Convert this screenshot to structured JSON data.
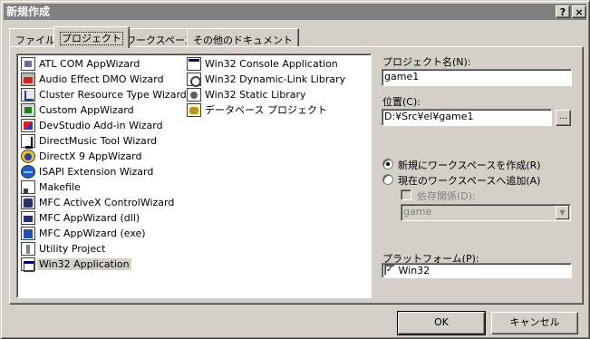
{
  "window": {
    "title": "新規作成",
    "help_label": "?",
    "close_label": "×"
  },
  "tabs": [
    {
      "label": "ファイル",
      "active": false
    },
    {
      "label": "プロジェクト",
      "active": true
    },
    {
      "label": "ワークスペース",
      "active": false
    },
    {
      "label": "その他のドキュメント",
      "active": false
    }
  ],
  "project_types_left": [
    {
      "label": "ATL COM AppWizard",
      "icon": "atl-wizard-icon"
    },
    {
      "label": "Audio Effect DMO Wizard",
      "icon": "audio-dmo-icon"
    },
    {
      "label": "Cluster Resource Type Wizard",
      "icon": "cluster-resource-icon"
    },
    {
      "label": "Custom AppWizard",
      "icon": "custom-wizard-icon"
    },
    {
      "label": "DevStudio Add-in Wizard",
      "icon": "devstudio-addin-icon"
    },
    {
      "label": "DirectMusic Tool Wizard",
      "icon": "directmusic-icon"
    },
    {
      "label": "DirectX 9 AppWizard",
      "icon": "directx-icon"
    },
    {
      "label": "ISAPI Extension Wizard",
      "icon": "isapi-icon"
    },
    {
      "label": "Makefile",
      "icon": "makefile-icon"
    },
    {
      "label": "MFC ActiveX ControlWizard",
      "icon": "mfc-activex-icon"
    },
    {
      "label": "MFC AppWizard (dll)",
      "icon": "mfc-dll-icon"
    },
    {
      "label": "MFC AppWizard (exe)",
      "icon": "mfc-exe-icon"
    },
    {
      "label": "Utility Project",
      "icon": "utility-icon"
    },
    {
      "label": "Win32 Application",
      "icon": "win32-app-icon",
      "selected": true
    }
  ],
  "project_types_right": [
    {
      "label": "Win32 Console Application",
      "icon": "console-app-icon"
    },
    {
      "label": "Win32 Dynamic-Link Library",
      "icon": "dll-icon"
    },
    {
      "label": "Win32 Static Library",
      "icon": "static-lib-icon"
    },
    {
      "label": "データベース プロジェクト",
      "icon": "database-icon"
    }
  ],
  "form": {
    "project_name_label": "プロジェクト名(N):",
    "project_name_value": "game1",
    "location_label": "位置(C):",
    "location_value": "D:¥Src¥el¥game1",
    "browse_label": "...",
    "radio_new_ws_label": "新規にワークスペースを作成(R)",
    "radio_add_ws_label": "現在のワークスペースへ追加(A)",
    "dependency_label": "依存関係(D):",
    "dependency_value": "game",
    "platform_label": "プラットフォーム(P):",
    "platform_value": "Win32",
    "platform_checked": "✓"
  },
  "buttons": {
    "ok": "OK",
    "cancel": "キャンセル"
  },
  "colors": {
    "face": "#d4d0c8",
    "titlebar_inactive": "#808080"
  }
}
